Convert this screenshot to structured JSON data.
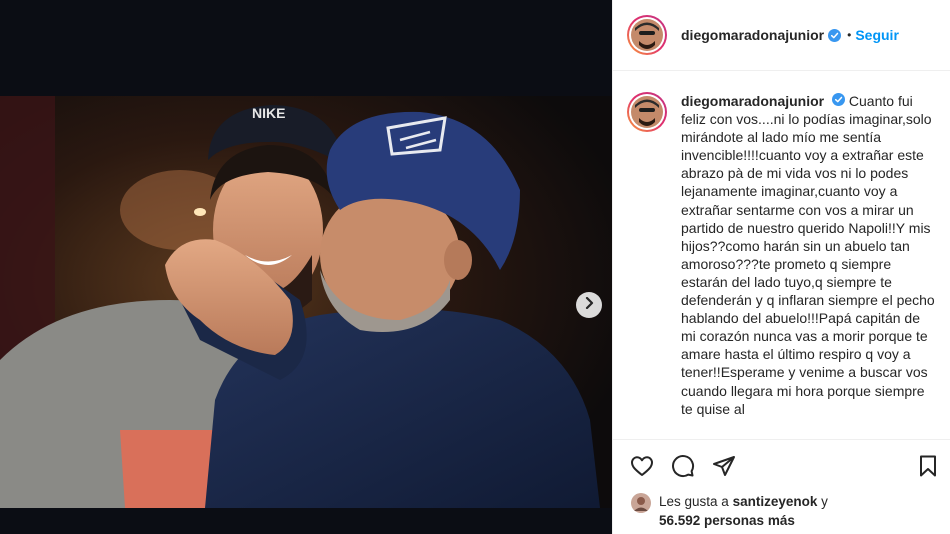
{
  "post": {
    "username": "diegomaradonajunior",
    "follow_label": "Seguir",
    "separator": "•",
    "caption": "Cuanto fui feliz con vos....ni lo podías imaginar,solo mirándote al lado mío me sentía invencible!!!!cuanto voy a extrañar este abrazo pà de mi vida vos ni lo podes lejanamente imaginar,cuanto voy a extrañar sentarme con vos a mirar un partido de nuestro querido Napoli!!Y mis hijos??como harán sin un abuelo tan amoroso???te prometo q siempre estarán del lado tuyo,q siempre te defenderán y q inflaran siempre el pecho hablando del abuelo!!!Papá capitán de mi corazón nunca vas a morir porque te amare hasta el último respiro q voy a tener!!Esperame y venime a buscar vos cuando llegara mi hora porque siempre te quise al"
  },
  "likes": {
    "prefix": "Les gusta a",
    "liker": "santizeyenok",
    "suffix": "y",
    "count": "56.592 personas más"
  },
  "icons": {
    "like": "heart-icon",
    "comment": "comment-icon",
    "share": "paper-plane-icon",
    "save": "bookmark-icon",
    "next": "chevron-right-icon",
    "verified": "verified-badge-icon"
  },
  "colors": {
    "accent": "#0095f6",
    "text": "#262626",
    "border": "#efefef",
    "media_bg": "#0b0d14"
  }
}
